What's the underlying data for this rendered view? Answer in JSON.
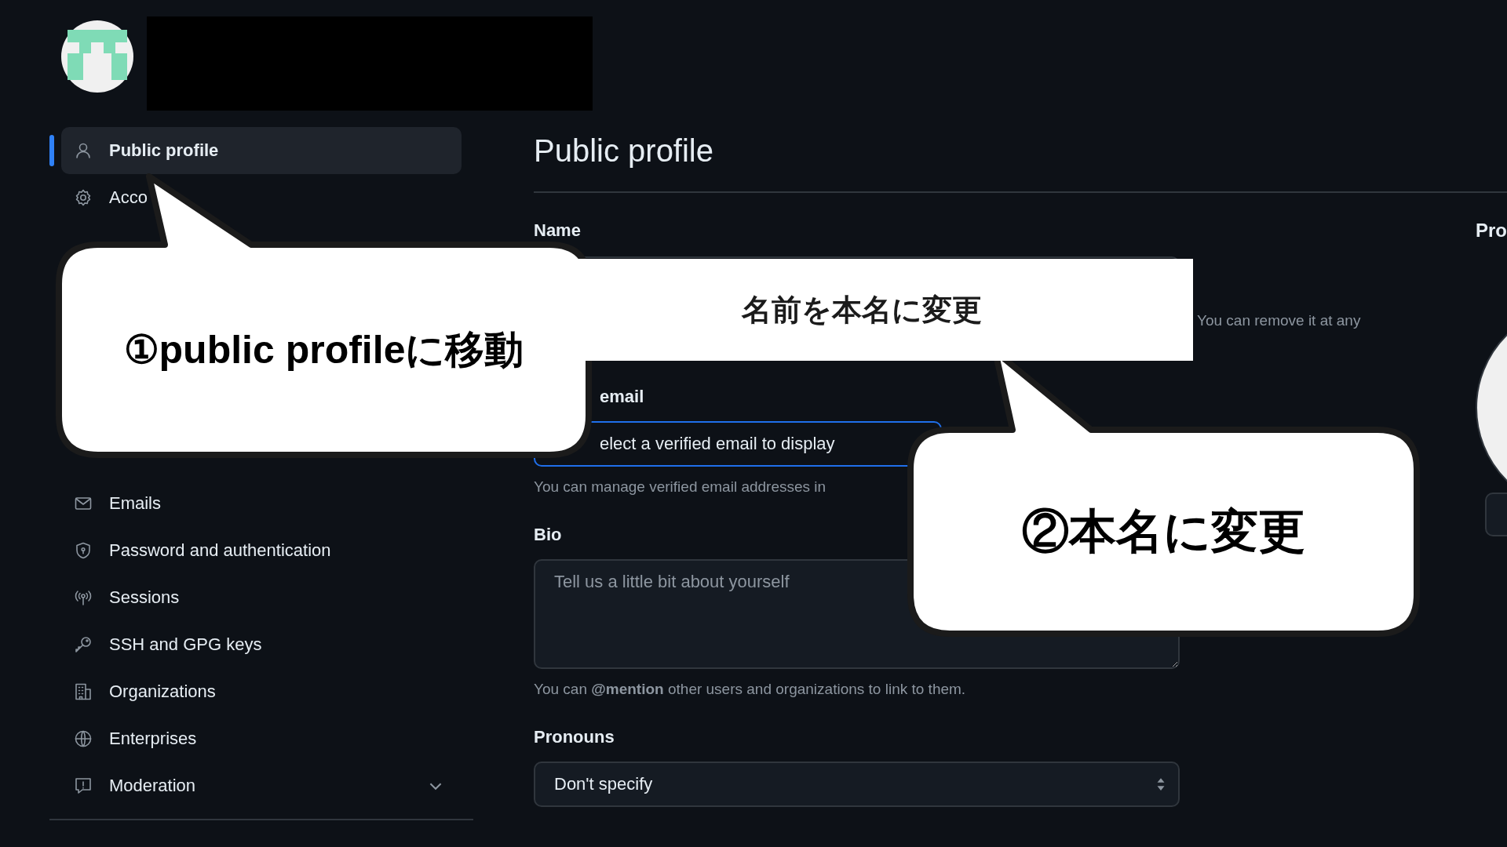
{
  "sidebar": {
    "items": [
      {
        "label": "Public profile",
        "selected": true,
        "submenu": false
      },
      {
        "label": "Acco",
        "selected": false,
        "submenu": false
      },
      {
        "label": "Emails",
        "selected": false,
        "submenu": false
      },
      {
        "label": "Password and authentication",
        "selected": false,
        "submenu": false
      },
      {
        "label": "Sessions",
        "selected": false,
        "submenu": false
      },
      {
        "label": "SSH and GPG keys",
        "selected": false,
        "submenu": false
      },
      {
        "label": "Organizations",
        "selected": false,
        "submenu": false
      },
      {
        "label": "Enterprises",
        "selected": false,
        "submenu": false
      },
      {
        "label": "Moderation",
        "selected": false,
        "submenu": true
      }
    ]
  },
  "main": {
    "title": "Public profile",
    "name": {
      "label": "Name",
      "hint": "You can remove it at any"
    },
    "email": {
      "label": "email",
      "value": "elect a verified email to display",
      "hint": "You can manage verified email addresses in"
    },
    "bio": {
      "label": "Bio",
      "placeholder": "Tell us a little bit about yourself",
      "hint": "You can **@mention** other users and organizations to link to them."
    },
    "pronouns": {
      "label": "Pronouns",
      "value": "Don't specify"
    }
  },
  "right": {
    "label": "Pro"
  },
  "annotations": {
    "note": "名前を本名に変更",
    "callouts": [
      "①public profileに移動",
      "②本名に変更"
    ]
  }
}
